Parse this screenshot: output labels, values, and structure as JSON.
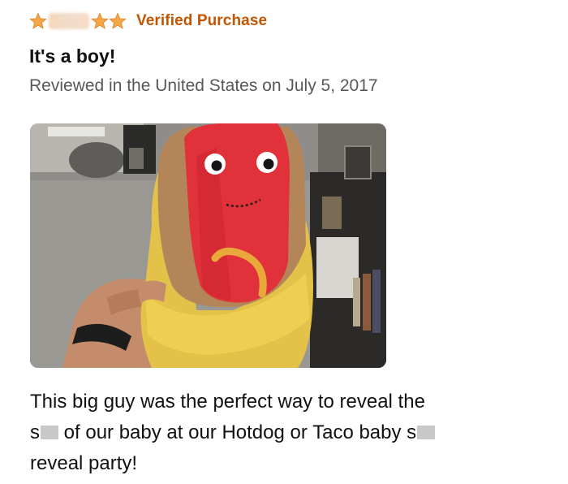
{
  "review": {
    "rating": {
      "visible_stars": 3,
      "redacted": true
    },
    "verified_label": "Verified Purchase",
    "title": "It's a boy!",
    "meta": "Reviewed in the United States on July 5, 2017",
    "photo": {
      "description_icon": "hotdog-plush-photo"
    },
    "body": {
      "line1": "This big guy was the perfect way to reveal the",
      "line2_a": "s",
      "line2_b": " of our baby at our Hotdog or Taco baby s",
      "line3": "reveal party!"
    }
  },
  "colors": {
    "star": "#f3a847",
    "verified": "#c45500",
    "meta": "#565959"
  }
}
